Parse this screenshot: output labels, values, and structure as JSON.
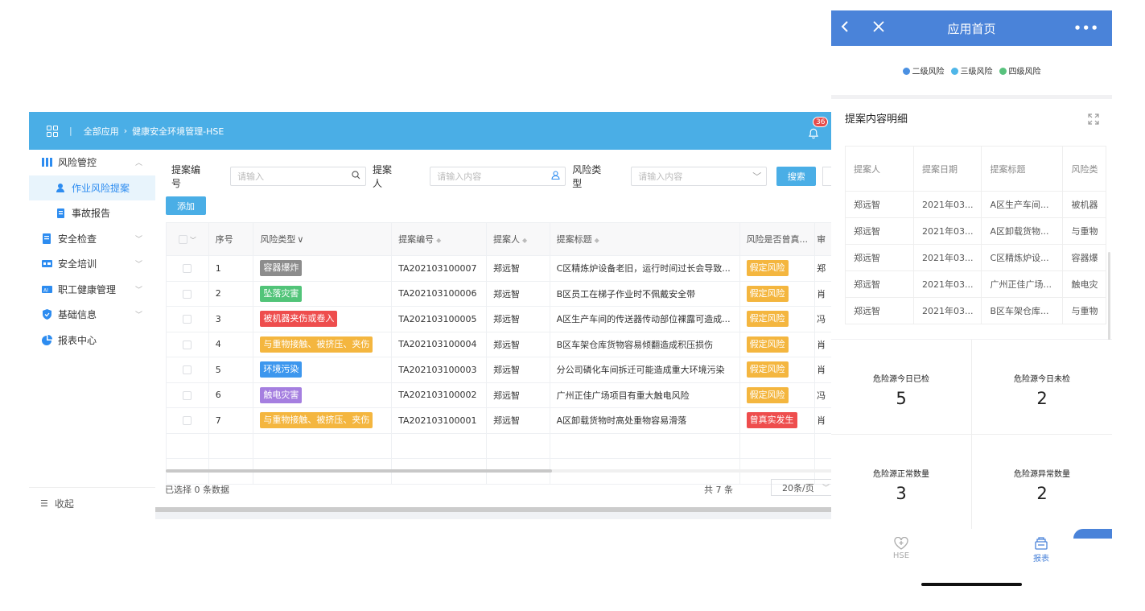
{
  "desktop": {
    "breadcrumb": {
      "separator": "|",
      "root": "全部应用",
      "chevron": "›",
      "current": "健康安全环境管理-HSE"
    },
    "notification_count": "36",
    "sidebar": {
      "items": [
        {
          "label": "风险管控",
          "icon": "bars-chart-icon",
          "arrow": "︿"
        },
        {
          "label": "作业风险提案",
          "icon": "worker-icon",
          "active": true
        },
        {
          "label": "事故报告",
          "icon": "clipboard-icon"
        },
        {
          "label": "安全检查",
          "icon": "checklist-icon",
          "arrow": "﹀"
        },
        {
          "label": "安全培训",
          "icon": "training-icon",
          "arrow": "﹀"
        },
        {
          "label": "职工健康管理",
          "icon": "health-icon",
          "arrow": "﹀"
        },
        {
          "label": "基础信息",
          "icon": "shield-icon",
          "arrow": "﹀"
        },
        {
          "label": "报表中心",
          "icon": "pie-chart-icon"
        }
      ],
      "collapse_label": "收起"
    },
    "filter": {
      "proposal_no_label": "提案编号",
      "proposal_no_placeholder": "请输入",
      "proposer_label": "提案人",
      "proposer_placeholder": "请输入内容",
      "risk_type_label": "风险类型",
      "risk_type_placeholder": "请输入内容",
      "search_label": "搜索"
    },
    "add_label": "添加",
    "table": {
      "headers": [
        "序号",
        "风险类型",
        "提案编号",
        "提案人",
        "提案标题",
        "风险是否曾真...",
        "审"
      ],
      "rows": [
        {
          "no": "1",
          "type": "容器爆炸",
          "type_color": "#8c8c8c",
          "code": "TA202103100007",
          "person": "郑远智",
          "title": "C区精炼炉设备老旧，运行时间过长会导致...",
          "status": "假定风险",
          "status_color": "#f4b63f",
          "auditor": "郑"
        },
        {
          "no": "2",
          "type": "坠落灾害",
          "type_color": "#52c479",
          "code": "TA202103100006",
          "person": "郑远智",
          "title": "B区员工在梯子作业时不佩戴安全带",
          "status": "假定风险",
          "status_color": "#f4b63f",
          "auditor": "肖"
        },
        {
          "no": "3",
          "type": "被机器夹伤或卷入",
          "type_color": "#ee4d4d",
          "code": "TA202103100005",
          "person": "郑远智",
          "title": "A区生产车间的传送器传动部位裸露可造成...",
          "status": "假定风险",
          "status_color": "#f4b63f",
          "auditor": "冯"
        },
        {
          "no": "4",
          "type": "与重物接触、被挤压、夹伤",
          "type_color": "#f4b63f",
          "code": "TA202103100004",
          "person": "郑远智",
          "title": "B区车架仓库货物容易倾翻造成积压损伤",
          "status": "假定风险",
          "status_color": "#f4b63f",
          "auditor": "肖"
        },
        {
          "no": "5",
          "type": "环境污染",
          "type_color": "#3d97ee",
          "code": "TA202103100003",
          "person": "郑远智",
          "title": "分公司磷化车间拆迁可能造成重大环境污染",
          "status": "假定风险",
          "status_color": "#f4b63f",
          "auditor": "肖"
        },
        {
          "no": "6",
          "type": "触电灾害",
          "type_color": "#a57fe0",
          "code": "TA202103100002",
          "person": "郑远智",
          "title": "广州正佳广场项目有重大触电风险",
          "status": "假定风险",
          "status_color": "#f4b63f",
          "auditor": "冯"
        },
        {
          "no": "7",
          "type": "与重物接触、被挤压、夹伤",
          "type_color": "#f4b63f",
          "code": "TA202103100001",
          "person": "郑远智",
          "title": "A区卸载货物时高处重物容易滑落",
          "status": "曾真实发生",
          "status_color": "#ee4d4d",
          "auditor": "肖"
        }
      ]
    },
    "footer": {
      "selected": "已选择 0 条数据",
      "total": "共 7 条",
      "page_size": "20条/页"
    }
  },
  "mobile": {
    "title": "应用首页",
    "legend": [
      {
        "label": "二级风险",
        "color": "#4a90e2"
      },
      {
        "label": "三级风险",
        "color": "#4fb6e8"
      },
      {
        "label": "四级风险",
        "color": "#58c27d"
      }
    ],
    "detail_title": "提案内容明细",
    "detail_headers": [
      "提案人",
      "提案日期",
      "提案标题",
      "风险类"
    ],
    "detail_rows": [
      [
        "郑远智",
        "2021年03...",
        "A区生产车间...",
        "被机器"
      ],
      [
        "郑远智",
        "2021年03...",
        "A区卸载货物...",
        "与重物"
      ],
      [
        "郑远智",
        "2021年03...",
        "C区精炼炉设...",
        "容器爆"
      ],
      [
        "郑远智",
        "2021年03...",
        "广州正佳广场...",
        "触电灾"
      ],
      [
        "郑远智",
        "2021年03...",
        "B区车架仓库...",
        "与重物"
      ]
    ],
    "stats": [
      {
        "label": "危险源今日已检",
        "value": "5"
      },
      {
        "label": "危险源今日未检",
        "value": "2"
      },
      {
        "label": "危险源正常数量",
        "value": "3"
      },
      {
        "label": "危险源异常数量",
        "value": "2"
      }
    ],
    "tabs": [
      {
        "label": "HSE",
        "icon": "heart-plus-icon",
        "active": false
      },
      {
        "label": "报表",
        "icon": "report-stack-icon",
        "active": true
      }
    ],
    "accent": "#4a83d9"
  }
}
